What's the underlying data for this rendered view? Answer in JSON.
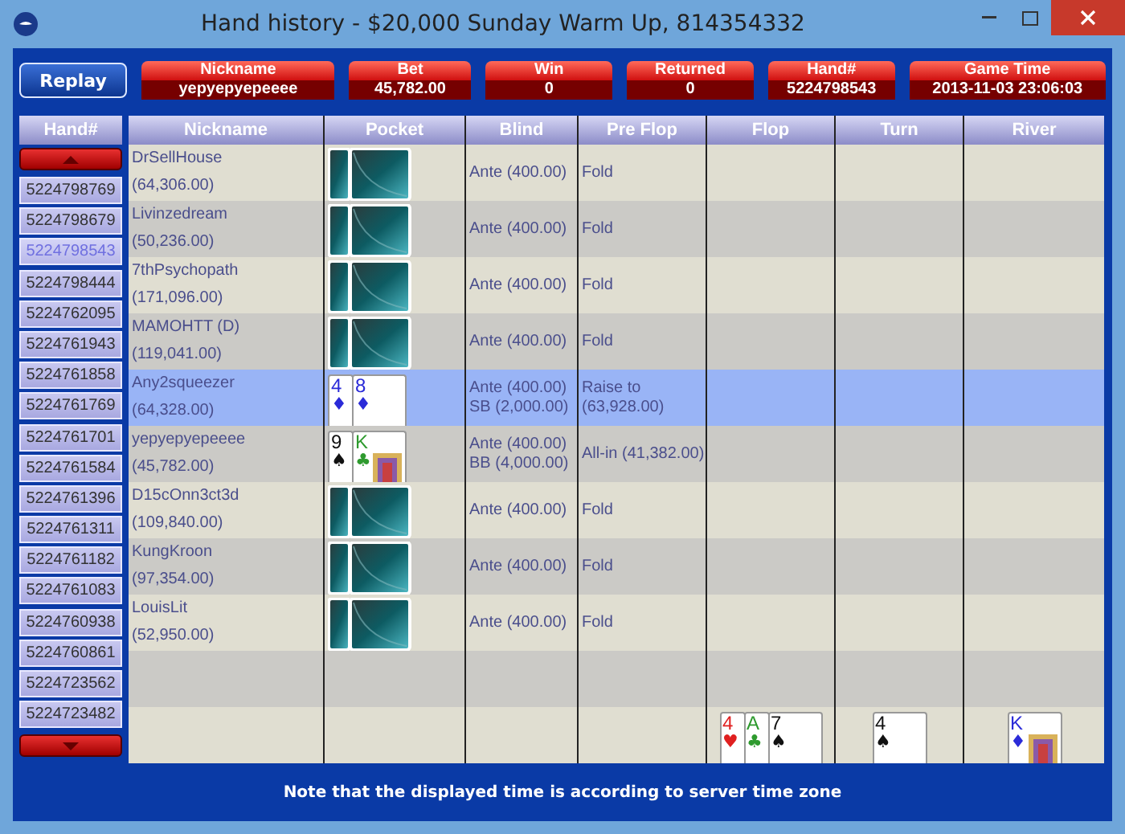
{
  "window": {
    "title": "Hand history - $20,000 Sunday Warm Up, 814354332"
  },
  "replay_button": "Replay",
  "summary": [
    {
      "label": "Nickname",
      "value": "yepyepyepeeee"
    },
    {
      "label": "Bet",
      "value": "45,782.00"
    },
    {
      "label": "Win",
      "value": "0"
    },
    {
      "label": "Returned",
      "value": "0"
    },
    {
      "label": "Hand#",
      "value": "5224798543"
    },
    {
      "label": "Game Time",
      "value": "2013-11-03 23:06:03"
    }
  ],
  "hand_list": {
    "header": "Hand#",
    "items": [
      {
        "label": "5224798769",
        "selected": false
      },
      {
        "label": "5224798679",
        "selected": false
      },
      {
        "label": "5224798543",
        "selected": true
      },
      {
        "label": "5224798444",
        "selected": false
      },
      {
        "label": "5224762095",
        "selected": false
      },
      {
        "label": "5224761943",
        "selected": false
      },
      {
        "label": "5224761858",
        "selected": false
      },
      {
        "label": "5224761769",
        "selected": false
      },
      {
        "label": "5224761701",
        "selected": false
      },
      {
        "label": "5224761584",
        "selected": false
      },
      {
        "label": "5224761396",
        "selected": false
      },
      {
        "label": "5224761311",
        "selected": false
      },
      {
        "label": "5224761182",
        "selected": false
      },
      {
        "label": "5224761083",
        "selected": false
      },
      {
        "label": "5224760938",
        "selected": false
      },
      {
        "label": "5224760861",
        "selected": false
      },
      {
        "label": "5224723562",
        "selected": false
      },
      {
        "label": "5224723482",
        "selected": false
      }
    ]
  },
  "table": {
    "columns": [
      "Nickname",
      "Pocket",
      "Blind",
      "Pre Flop",
      "Flop",
      "Turn",
      "River"
    ],
    "rows": [
      {
        "nickname": "DrSellHouse",
        "stack": "(64,306.00)",
        "pocket": {
          "kind": "hidden"
        },
        "blind": [
          "Ante (400.00)"
        ],
        "preflop": [
          "Fold"
        ],
        "selected": false
      },
      {
        "nickname": "Livinzedream",
        "stack": "(50,236.00)",
        "pocket": {
          "kind": "hidden"
        },
        "blind": [
          "Ante (400.00)"
        ],
        "preflop": [
          "Fold"
        ],
        "selected": false
      },
      {
        "nickname": "7thPsychopath",
        "stack": "(171,096.00)",
        "pocket": {
          "kind": "hidden"
        },
        "blind": [
          "Ante (400.00)"
        ],
        "preflop": [
          "Fold"
        ],
        "selected": false
      },
      {
        "nickname": "MAMOHTT (D)",
        "stack": "(119,041.00)",
        "pocket": {
          "kind": "hidden"
        },
        "blind": [
          "Ante (400.00)"
        ],
        "preflop": [
          "Fold"
        ],
        "selected": false
      },
      {
        "nickname": "Any2squeezer",
        "stack": "(64,328.00)",
        "pocket": {
          "kind": "shown",
          "cards": [
            {
              "rank": "4",
              "suit": "♦",
              "color": "#2b2bd8",
              "court": false
            },
            {
              "rank": "8",
              "suit": "♦",
              "color": "#2b2bd8",
              "court": false
            }
          ]
        },
        "blind": [
          "Ante (400.00)",
          "SB (2,000.00)"
        ],
        "preflop": [
          "Raise to",
          "(63,928.00)"
        ],
        "selected": true
      },
      {
        "nickname": "yepyepyepeeee",
        "stack": "(45,782.00)",
        "pocket": {
          "kind": "shown",
          "cards": [
            {
              "rank": "9",
              "suit": "♠",
              "color": "#111111",
              "court": false
            },
            {
              "rank": "K",
              "suit": "♣",
              "color": "#2e9a2e",
              "court": true
            }
          ]
        },
        "blind": [
          "Ante (400.00)",
          "BB (4,000.00)"
        ],
        "preflop": [
          "All-in (41,382.00)"
        ],
        "selected": false
      },
      {
        "nickname": "D15cOnn3ct3d",
        "stack": "(109,840.00)",
        "pocket": {
          "kind": "hidden"
        },
        "blind": [
          "Ante (400.00)"
        ],
        "preflop": [
          "Fold"
        ],
        "selected": false
      },
      {
        "nickname": "KungKroon",
        "stack": "(97,354.00)",
        "pocket": {
          "kind": "hidden"
        },
        "blind": [
          "Ante (400.00)"
        ],
        "preflop": [
          "Fold"
        ],
        "selected": false
      },
      {
        "nickname": "LouisLit",
        "stack": "(52,950.00)",
        "pocket": {
          "kind": "hidden"
        },
        "blind": [
          "Ante (400.00)"
        ],
        "preflop": [
          "Fold"
        ],
        "selected": false
      }
    ],
    "board": {
      "flop": [
        {
          "rank": "4",
          "suit": "♥",
          "color": "#e02020",
          "court": false
        },
        {
          "rank": "A",
          "suit": "♣",
          "color": "#2e9a2e",
          "court": false
        },
        {
          "rank": "7",
          "suit": "♠",
          "color": "#111111",
          "court": false
        }
      ],
      "turn": [
        {
          "rank": "4",
          "suit": "♠",
          "color": "#111111",
          "court": false
        }
      ],
      "river": [
        {
          "rank": "K",
          "suit": "♦",
          "color": "#2b2bd8",
          "court": true
        }
      ]
    }
  },
  "note": "Note that the displayed time is according to server time zone"
}
